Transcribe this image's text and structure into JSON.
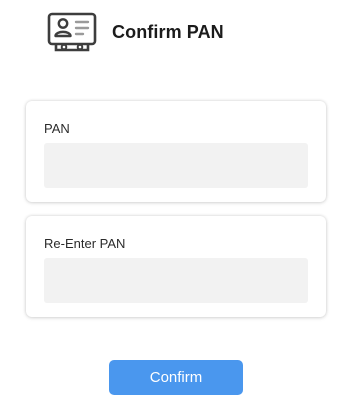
{
  "header": {
    "title": "Confirm PAN",
    "icon": "id-card-icon"
  },
  "form": {
    "pan": {
      "label": "PAN",
      "value": "",
      "placeholder": ""
    },
    "re_pan": {
      "label": "Re-Enter PAN",
      "value": "",
      "placeholder": ""
    }
  },
  "actions": {
    "confirm_label": "Confirm"
  },
  "colors": {
    "accent": "#4a97ee",
    "input_bg": "#f2f2f2",
    "icon_stroke": "#3d3d3d"
  }
}
